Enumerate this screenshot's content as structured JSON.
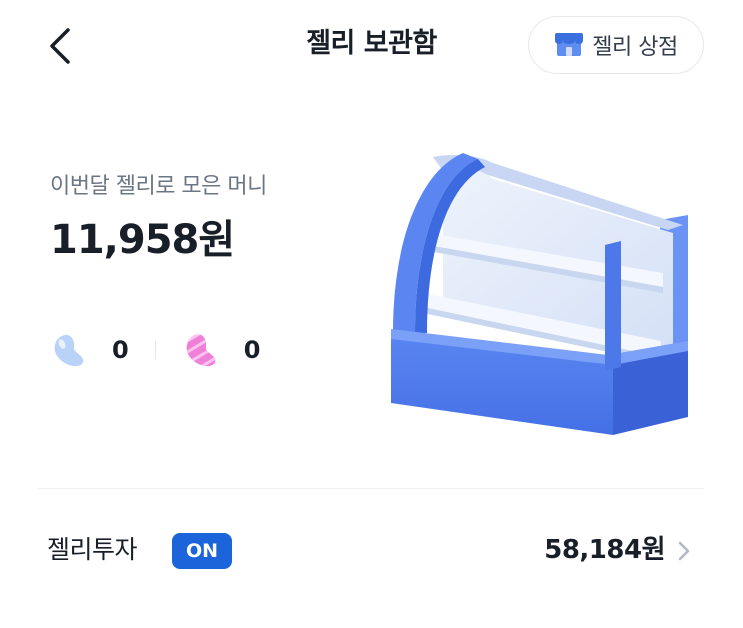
{
  "header": {
    "title": "젤리 보관함",
    "back_icon": "chevron-left-icon",
    "store_button": {
      "label": "젤리 상점",
      "icon": "store-icon"
    }
  },
  "summary": {
    "label": "이번달 젤리로 모은 머니",
    "amount": "11,958원"
  },
  "jellies": [
    {
      "icon": "blue-jelly-icon",
      "count": "0",
      "color": "#b9d2f8"
    },
    {
      "icon": "pink-jelly-icon",
      "count": "0",
      "color": "#f07fd8"
    }
  ],
  "illustration": {
    "name": "display-case-illustration",
    "color": "#4f7df0"
  },
  "investment": {
    "label": "젤리투자",
    "status_badge": "ON",
    "amount": "58,184원",
    "arrow_icon": "chevron-right-icon"
  },
  "colors": {
    "accent": "#1b64da",
    "text": "#191f28",
    "subtext": "#6b7684"
  }
}
